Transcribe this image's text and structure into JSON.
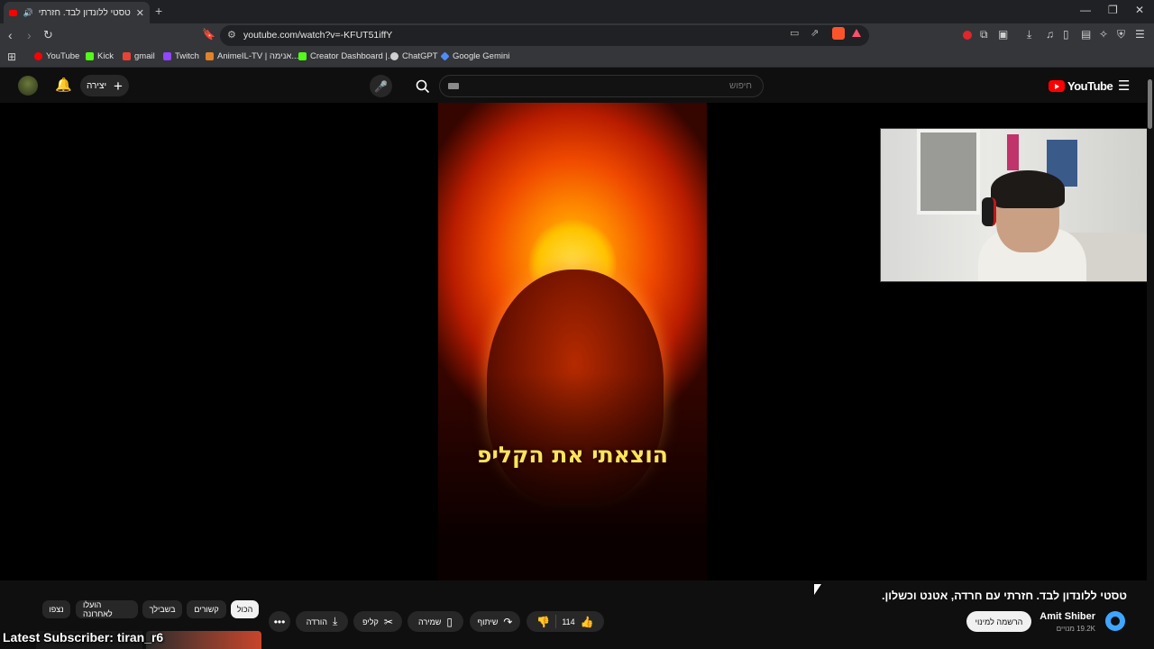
{
  "browser": {
    "tab_title": "טסטי ללונדון לבד. חזרתי עם ח",
    "url": "youtube.com/watch?v=-KFUT51iffY",
    "bookmarks": [
      {
        "label": "YouTube",
        "color": "#ff0000"
      },
      {
        "label": "Kick",
        "color": "#53fc18"
      },
      {
        "label": "gmail",
        "color": "#ea4335"
      },
      {
        "label": "Twitch",
        "color": "#9146ff"
      },
      {
        "label": "AnimeIL-TV | אנימה...",
        "color": "#e0842a"
      },
      {
        "label": "Creator Dashboard |...",
        "color": "#53fc18"
      },
      {
        "label": "ChatGPT",
        "color": "#cfcfcf"
      },
      {
        "label": "Google Gemini",
        "color": "#4f8cf5"
      }
    ]
  },
  "youtube": {
    "create_label": "יצירה",
    "search_placeholder": "חיפוש",
    "logo_text": "YouTube"
  },
  "video": {
    "caption": "הוצאתי את הקליפ",
    "title": "טסטי ללונדון לבד. חזרתי עם חרדה, אטנט וכשלון.",
    "channel_name": "Amit Shiber",
    "channel_subs": "19.2K מנויים",
    "subscribe_label": "הרשמה למינוי",
    "like_count": "114",
    "share_label": "שיתוף",
    "save_label": "שמירה",
    "clip_label": "קליפ",
    "download_label": "הורדה"
  },
  "filter_chips": [
    "הכול",
    "קשורים",
    "בשבילך",
    "הועלו לאחרונה",
    "נצפו"
  ],
  "stream_overlay": "Latest Subscriber: tiran_r6",
  "colors": {
    "accent": "#ff0000",
    "background": "#0f0f0f"
  }
}
